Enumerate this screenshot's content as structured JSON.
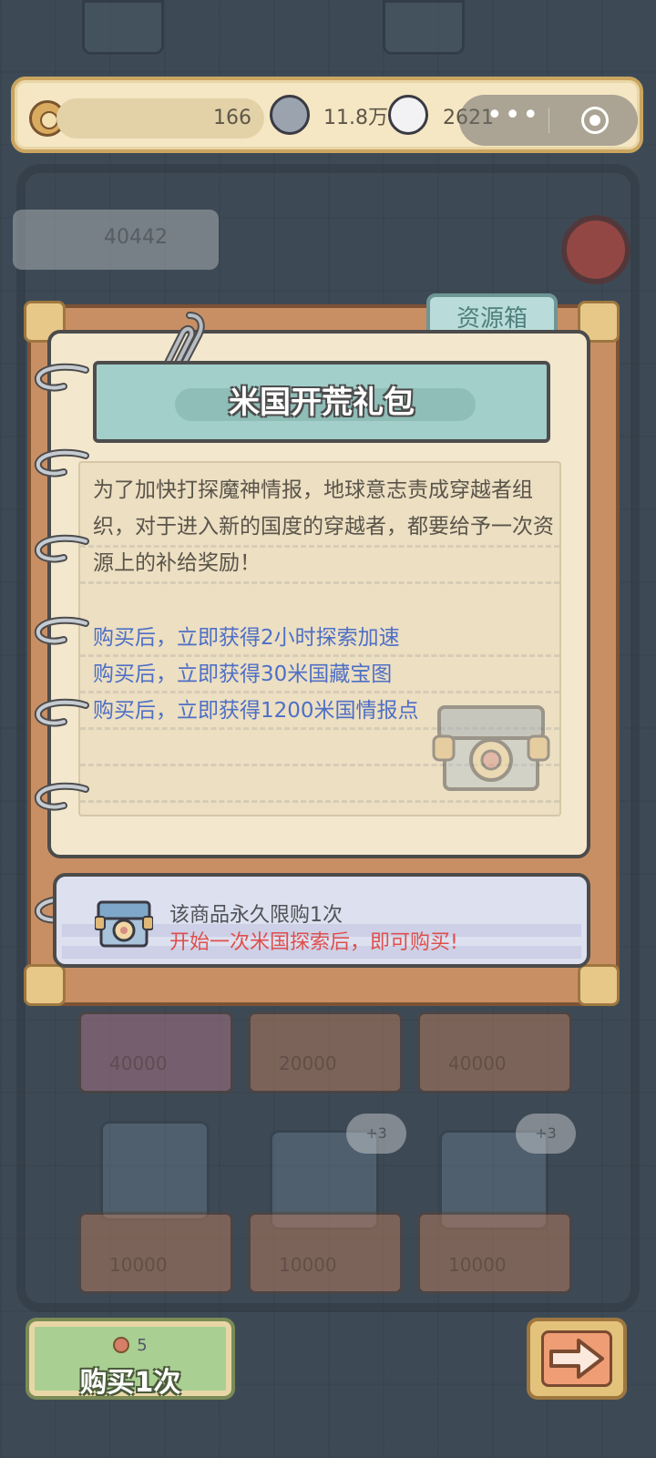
{
  "topbar": {
    "resources": [
      {
        "name": "badge",
        "value": "166"
      },
      {
        "name": "dark-coin",
        "value": "11.8万"
      },
      {
        "name": "light-coin",
        "value": "2621"
      }
    ]
  },
  "wechat_capsule": {
    "more_glyph": "•••"
  },
  "background": {
    "ghost_counter": "40442",
    "ghost_prices": [
      "40000",
      "20000",
      "40000",
      "10000",
      "10000",
      "10000"
    ],
    "ghost_bubbles": [
      "+3",
      "+3"
    ]
  },
  "notebook": {
    "tab_label": "资源箱",
    "title": "米国开荒礼包",
    "description": "为了加快打探魔神情报，地球意志责成穿越者组织，对于进入新的国度的穿越者，都要给予一次资源上的补给奖励！",
    "benefits": [
      "购买后，立即获得2小时探索加速",
      "购买后，立即获得30米国藏宝图",
      "购买后，立即获得1200米国情报点"
    ]
  },
  "limit": {
    "line1": "该商品永久限购1次",
    "line2": "开始一次米国探索后，即可购买!"
  },
  "buy_button": {
    "cost": "5",
    "label": "购买1次"
  },
  "colors": {
    "accent_teal": "#a2cfca",
    "benefit_blue": "#4e6fc6",
    "warning_red": "#df4f4d",
    "buy_green": "#a9cf93"
  }
}
